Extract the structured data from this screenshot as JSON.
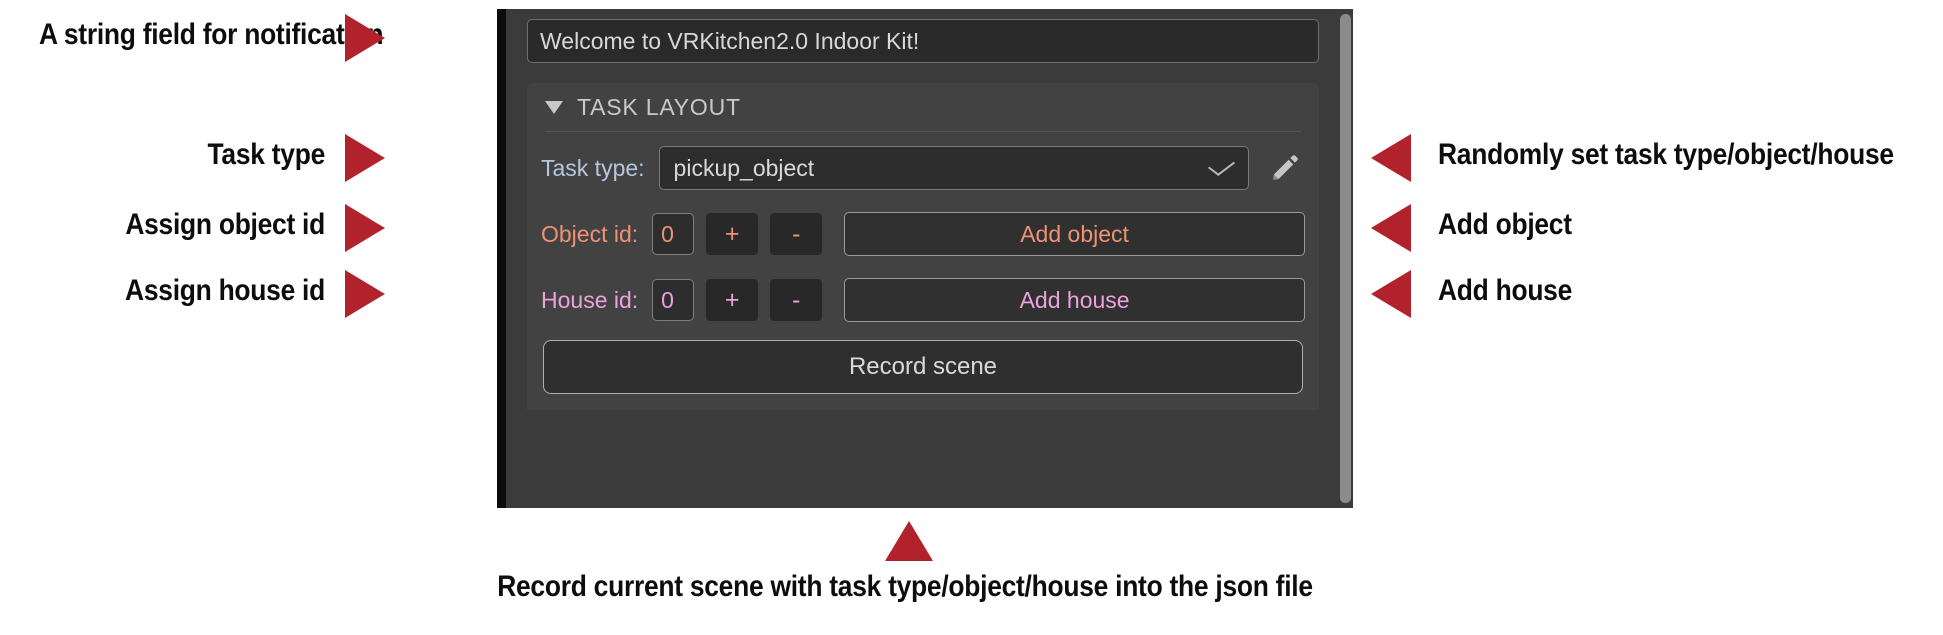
{
  "panel": {
    "notification_field": {
      "value": "Welcome to VRKitchen2.0 Indoor Kit!",
      "placeholder": "Welcome to VRKitchen2.0 Indoor Kit!"
    },
    "category": {
      "title": "TASK LAYOUT",
      "expanded": true
    },
    "task_type_row": {
      "label": "Task type:",
      "value": "pickup_object",
      "label_color": "#b6c7dd"
    },
    "object_row": {
      "label": "Object id:",
      "value": "0",
      "increment_label": "+",
      "decrement_label": "-",
      "button_label": "Add object",
      "label_color": "#ef9273"
    },
    "house_row": {
      "label": "House id:",
      "value": "0",
      "increment_label": "+",
      "decrement_label": "-",
      "button_label": "Add house",
      "label_color": "#eda2dd"
    },
    "record_button": {
      "label": "Record scene"
    }
  },
  "annotations": {
    "arrow_color": "#b2222c",
    "left": [
      {
        "text": "A string field for notification"
      },
      {
        "text": "Task type"
      },
      {
        "text": "Assign object id"
      },
      {
        "text": "Assign house id"
      }
    ],
    "right": [
      {
        "text": "Randomly set task type/object/house"
      },
      {
        "text": "Add object"
      },
      {
        "text": "Add house"
      }
    ],
    "bottom": {
      "text": "Record current scene with  task type/object/house into the json file"
    }
  }
}
